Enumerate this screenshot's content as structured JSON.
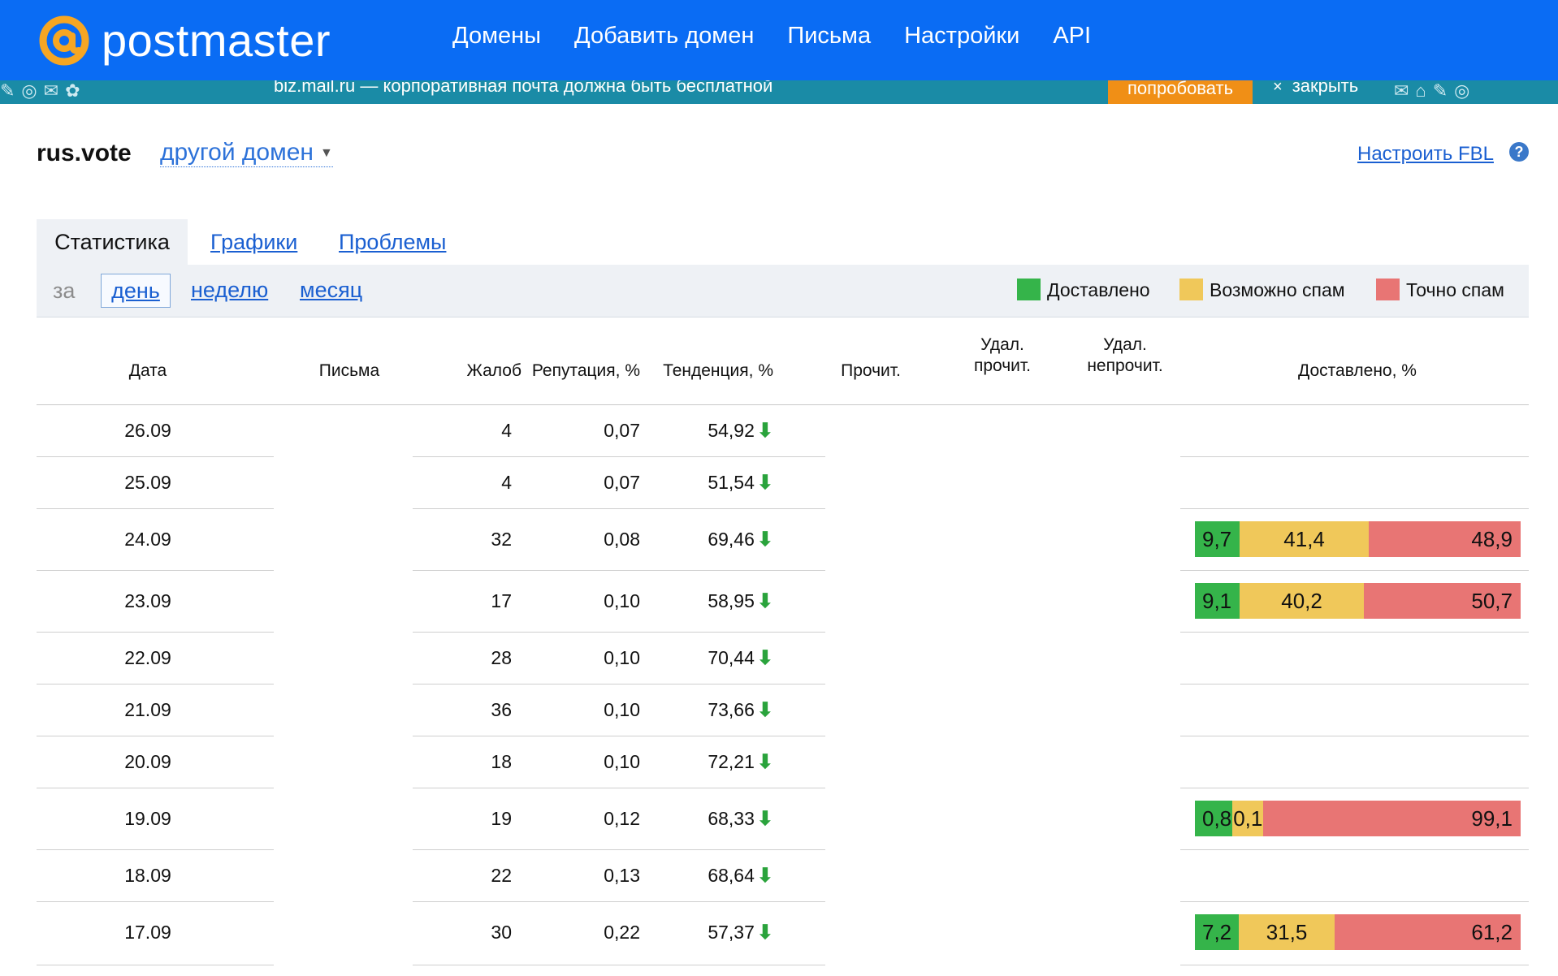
{
  "header": {
    "logo_text": "postmaster",
    "logo_icon": "at-sign-icon",
    "nav": [
      "Домены",
      "Добавить домен",
      "Письма",
      "Настройки",
      "API"
    ]
  },
  "promo": {
    "text": "biz.mail.ru — корпоративная почта должна быть бесплатной",
    "button": "попробовать",
    "close_label": "закрыть"
  },
  "domain": {
    "name": "rus.vote",
    "other_domain": "другой домен",
    "fbl_link": "Настроить FBL"
  },
  "tabs": [
    "Статистика",
    "Графики",
    "Проблемы"
  ],
  "period": {
    "prefix": "за",
    "options": [
      "день",
      "неделю",
      "месяц"
    ],
    "selected": "день"
  },
  "legend": [
    {
      "label": "Доставлено",
      "color": "#35b44a"
    },
    {
      "label": "Возможно спам",
      "color": "#f0c85a"
    },
    {
      "label": "Точно спам",
      "color": "#e87574"
    }
  ],
  "columns": {
    "date": "Дата",
    "letters": "Письма",
    "complaints": "Жалоб",
    "reputation": "Репутация, %",
    "trend": "Тенденция, %",
    "read": "Прочит.",
    "deleted_read_1": "Удал.",
    "deleted_read_2": "прочит.",
    "deleted_unread_1": "Удал.",
    "deleted_unread_2": "непрочит.",
    "delivered": "Доставлено, %"
  },
  "rows": [
    {
      "date": "26.09",
      "complaints": "4",
      "reputation": "0,07",
      "trend": "54,92",
      "delivery": null
    },
    {
      "date": "25.09",
      "complaints": "4",
      "reputation": "0,07",
      "trend": "51,54",
      "delivery": null
    },
    {
      "date": "24.09",
      "complaints": "32",
      "reputation": "0,08",
      "trend": "69,46",
      "delivery": {
        "delivered": "9,7",
        "maybe_spam": "41,4",
        "spam": "48,9"
      }
    },
    {
      "date": "23.09",
      "complaints": "17",
      "reputation": "0,10",
      "trend": "58,95",
      "delivery": {
        "delivered": "9,1",
        "maybe_spam": "40,2",
        "spam": "50,7"
      }
    },
    {
      "date": "22.09",
      "complaints": "28",
      "reputation": "0,10",
      "trend": "70,44",
      "delivery": null
    },
    {
      "date": "21.09",
      "complaints": "36",
      "reputation": "0,10",
      "trend": "73,66",
      "delivery": null
    },
    {
      "date": "20.09",
      "complaints": "18",
      "reputation": "0,10",
      "trend": "72,21",
      "delivery": null
    },
    {
      "date": "19.09",
      "complaints": "19",
      "reputation": "0,12",
      "trend": "68,33",
      "delivery": {
        "delivered": "0,8",
        "maybe_spam": "0,1",
        "spam": "99,1"
      }
    },
    {
      "date": "18.09",
      "complaints": "22",
      "reputation": "0,13",
      "trend": "68,64",
      "delivery": null
    },
    {
      "date": "17.09",
      "complaints": "30",
      "reputation": "0,22",
      "trend": "57,37",
      "delivery": {
        "delivered": "7,2",
        "maybe_spam": "31,5",
        "spam": "61,2"
      }
    }
  ]
}
